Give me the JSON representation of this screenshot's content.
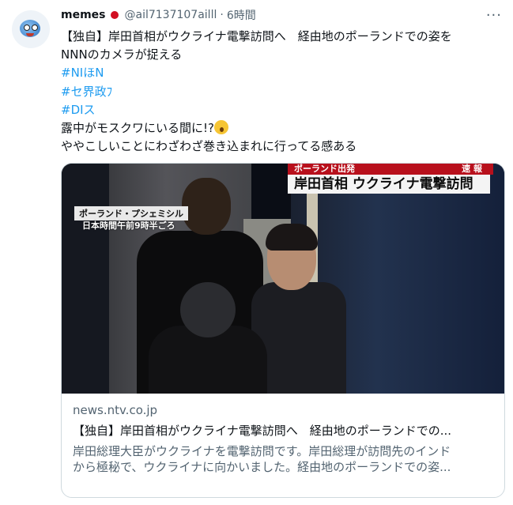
{
  "header": {
    "name": "memes",
    "handle": "@ail7137107ailll",
    "separator": "·",
    "time": "6時間",
    "more_icon": "more-horizontal-icon"
  },
  "tweet": {
    "line1": "【独自】岸田首相がウクライナ電撃訪問へ　経由地のポーランドでの姿を",
    "line2": "NNNのカメラが捉える",
    "hashtags": [
      "#NIほN",
      "#セ界政ﾌ",
      "#DIス"
    ],
    "line3": "露中がモスクワにいる間に!?",
    "line4": "ややこしいことにわざわざ巻き込まれに行ってる感ある",
    "emoji": "astonished-face"
  },
  "card": {
    "image": {
      "red_caption_left": "ポーランド出発",
      "red_caption_right": "速 報",
      "headline": "岸田首相 ウクライナ電撃訪問",
      "location": "ポーランド・プシェミシル",
      "time_note": "日本時間午前9時半ごろ"
    },
    "domain": "news.ntv.co.jp",
    "title": "【独自】岸田首相がウクライナ電撃訪問へ　経由地のポーランドでの...",
    "description_line1": "岸田総理大臣がウクライナを電撃訪問です。岸田総理が訪問先のインド",
    "description_line2": "から極秘で、ウクライナに向かいました。経由地のポーランドでの姿..."
  },
  "colors": {
    "link": "#1d9bf0",
    "muted": "#536471",
    "border": "#cfd9de",
    "breaking_red": "#b8101c"
  }
}
